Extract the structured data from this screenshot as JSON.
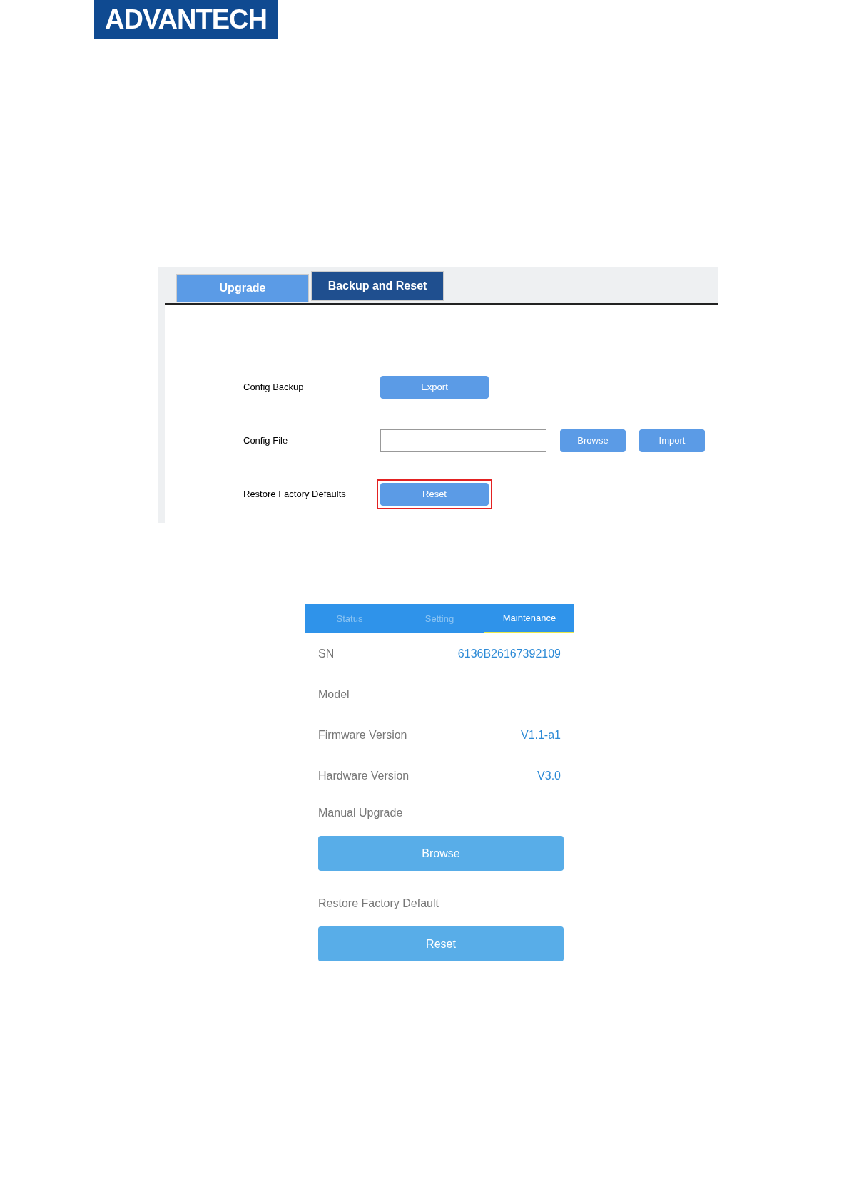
{
  "logo": {
    "text": "ADVANTECH"
  },
  "web_screen": {
    "tabs": [
      {
        "label": "Upgrade",
        "selected": false
      },
      {
        "label": "Backup and Reset",
        "selected": true
      }
    ],
    "rows": [
      {
        "label": "Config Backup",
        "kind": "button",
        "button": "Export",
        "highlighted": false
      },
      {
        "label": "Config File",
        "kind": "file",
        "buttons": [
          "Browse",
          "Import"
        ]
      },
      {
        "label": "Restore Factory Defaults",
        "kind": "button",
        "button": "Reset",
        "highlighted": true
      }
    ]
  },
  "app_screen": {
    "tabs": [
      {
        "label": "Status",
        "selected": false
      },
      {
        "label": "Setting",
        "selected": false
      },
      {
        "label": "Maintenance",
        "selected": true
      }
    ],
    "info": [
      {
        "label": "SN",
        "value": "6136B26167392109"
      },
      {
        "label": "Model"
      },
      {
        "label": "Firmware Version",
        "value": "V1.1-a1"
      },
      {
        "label": "Hardware Version",
        "value": "V3.0"
      }
    ],
    "sections": [
      {
        "title": "Manual Upgrade",
        "button": "Browse"
      },
      {
        "title": "Restore Factory Default",
        "button": "Reset"
      }
    ]
  }
}
